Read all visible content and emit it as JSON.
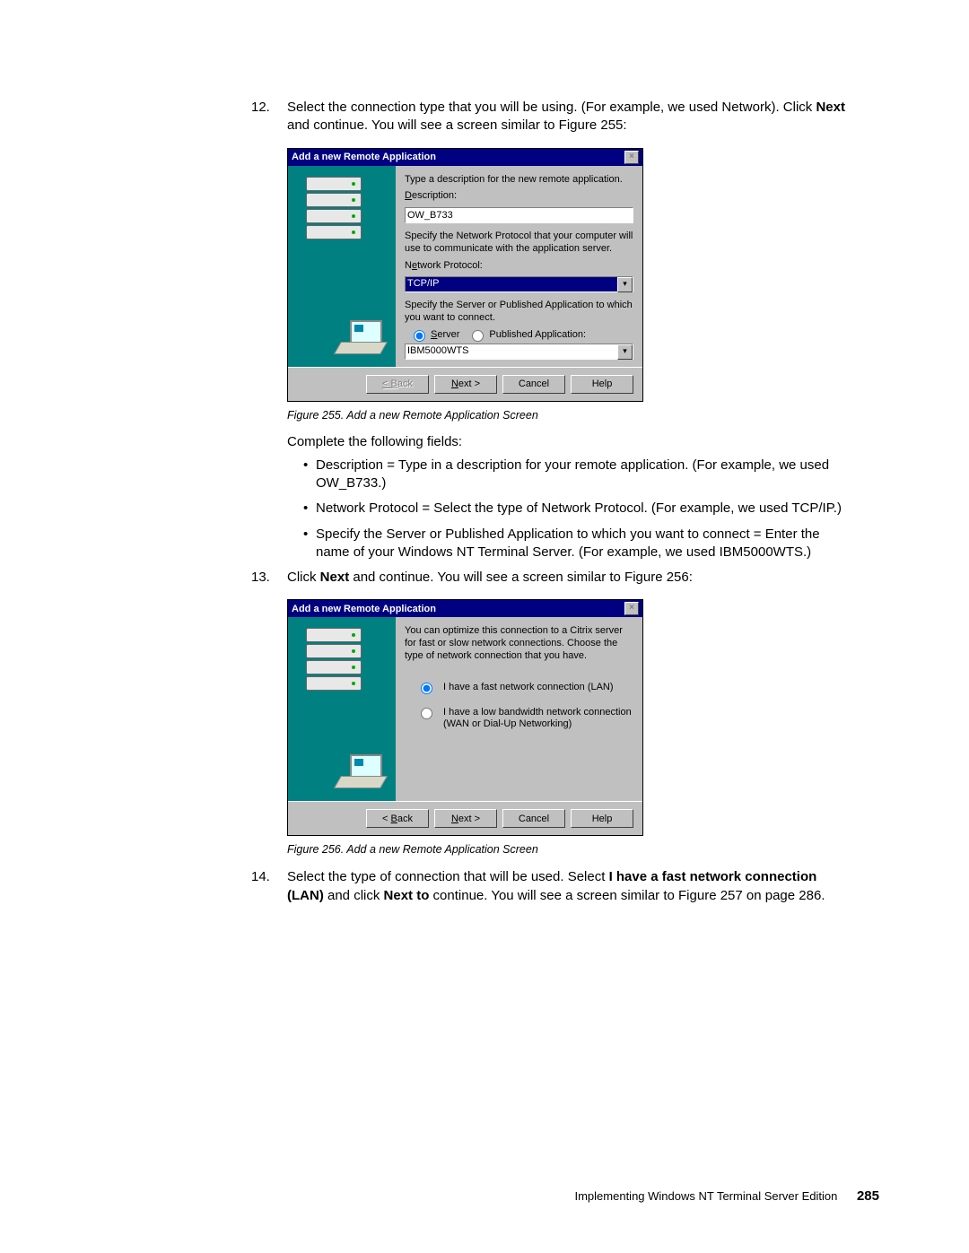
{
  "step12": {
    "num": "12.",
    "text_before": "Select the connection type that you will be using. (For example, we used Network). Click ",
    "text_bold": "Next",
    "text_after": " and continue. You will see a screen similar to Figure 255:"
  },
  "dialog1": {
    "title": "Add a new Remote Application",
    "intro": "Type a description for the new remote application.",
    "desc_label": "Description:",
    "desc_value": "OW_B733",
    "proto_intro": "Specify the Network Protocol that your computer will use to communicate with the application server.",
    "proto_label": "Network Protocol:",
    "proto_value": "TCP/IP",
    "server_intro": "Specify the Server or Published Application to which you want to connect.",
    "radio_server": "Server",
    "radio_pubapp": "Published Application:",
    "server_value": "IBM5000WTS",
    "btn_back": "< Back",
    "btn_next": "Next >",
    "btn_cancel": "Cancel",
    "btn_help": "Help"
  },
  "caption1": "Figure 255.  Add a new Remote Application Screen",
  "para_complete": "Complete the following fields:",
  "bullets": [
    "Description = Type in a description for your remote application. (For example, we used OW_B733.)",
    "Network Protocol = Select the type of Network Protocol. (For example, we used TCP/IP.)",
    "Specify the Server or Published Application to which you want to connect = Enter the name of your Windows NT Terminal Server. (For example, we used IBM5000WTS.)"
  ],
  "step13": {
    "num": "13.",
    "text_before": "Click ",
    "text_bold": "Next",
    "text_after": " and continue. You will see a screen similar to Figure 256:"
  },
  "dialog2": {
    "title": "Add a new Remote Application",
    "intro": "You can optimize this connection to a Citrix server for fast or slow network connections.  Choose the type of network connection that you have.",
    "radio_fast": "I have a fast network connection (LAN)",
    "radio_slow": "I have a low bandwidth network connection (WAN or Dial-Up Networking)",
    "btn_back": "< Back",
    "btn_next": "Next >",
    "btn_cancel": "Cancel",
    "btn_help": "Help"
  },
  "caption2": "Figure 256.  Add a new Remote Application Screen",
  "step14": {
    "num": "14.",
    "text_a": "Select the type of connection that will be used. Select ",
    "bold_a": "I have a fast network connection (LAN)",
    "text_b": " and click ",
    "bold_b": "Next to",
    "text_c": " continue. You will see a screen similar to Figure 257 on page 286."
  },
  "footer": {
    "text": "Implementing Windows NT Terminal Server Edition",
    "page": "285"
  }
}
